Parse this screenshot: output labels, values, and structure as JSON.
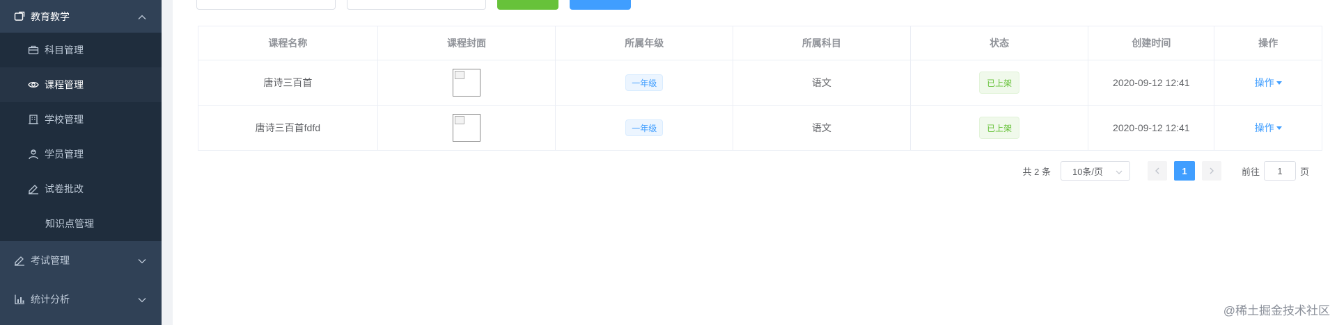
{
  "sidebar": {
    "open_group": "教育教学",
    "items": [
      {
        "label": "科目管理",
        "icon": "briefcase-icon"
      },
      {
        "label": "课程管理",
        "icon": "eye-icon",
        "active": true
      },
      {
        "label": "学校管理",
        "icon": "building-icon"
      },
      {
        "label": "学员管理",
        "icon": "user-icon"
      },
      {
        "label": "试卷批改",
        "icon": "edit-icon"
      },
      {
        "label": "知识点管理",
        "icon": ""
      }
    ],
    "groups": [
      {
        "label": "考试管理",
        "icon": "exam-icon"
      },
      {
        "label": "统计分析",
        "icon": "chart-icon"
      }
    ]
  },
  "table": {
    "headers": [
      "课程名称",
      "课程封面",
      "所属年级",
      "所属科目",
      "状态",
      "创建时间",
      "操作"
    ],
    "rows": [
      {
        "name": "唐诗三百首",
        "grade": "一年级",
        "subject": "语文",
        "status": "已上架",
        "created": "2020-09-12 12:41",
        "action": "操作"
      },
      {
        "name": "唐诗三百首fdfd",
        "grade": "一年级",
        "subject": "语文",
        "status": "已上架",
        "created": "2020-09-12 12:41",
        "action": "操作"
      }
    ]
  },
  "pagination": {
    "total": "共 2 条",
    "page_size": "10条/页",
    "current_page": "1",
    "goto_label": "前往",
    "goto_value": "1",
    "page_unit": "页"
  },
  "watermark": "@稀土掘金技术社区",
  "colors": {
    "sidebar_bg": "#304156",
    "primary": "#409eff",
    "success": "#67c23a"
  }
}
